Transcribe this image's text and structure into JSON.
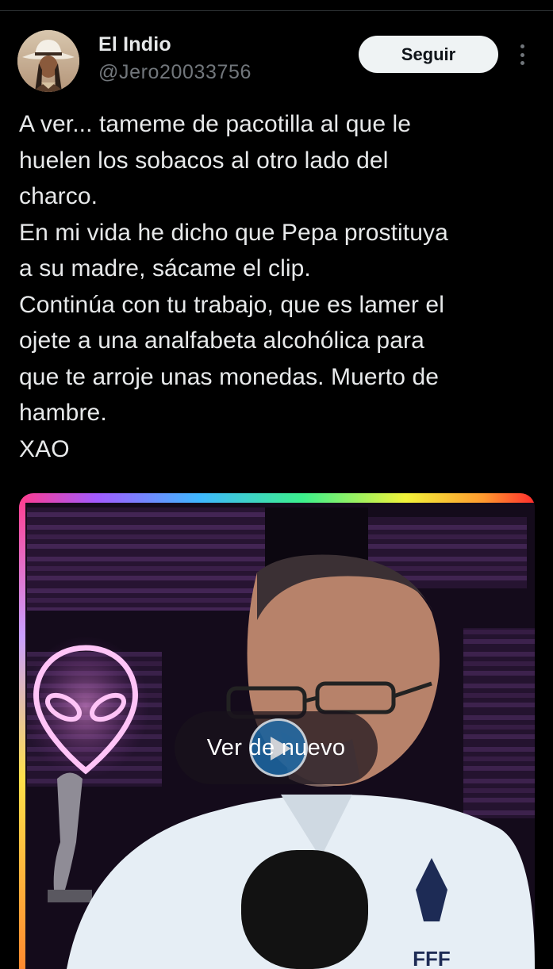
{
  "author": {
    "display_name": "El Indio",
    "handle": "@Jero20033756",
    "avatar_icon": "avatar-photo-cowboy-hat"
  },
  "actions": {
    "follow_label": "Seguir",
    "more_icon": "more-vertical-icon"
  },
  "tweet": {
    "lines": [
      "A ver... tameme de pacotilla al que le",
      "huelen los sobacos al otro lado del",
      "charco.",
      "En mi vida he dicho que Pepa prostituya",
      "a su madre, sácame el clip.",
      "Continúa con tu trabajo, que es lamer el",
      "ojete a una analfabeta alcohólica para",
      "que te arroje unas monedas. Muerto de",
      "hambre.",
      "XAO"
    ]
  },
  "media": {
    "type": "video",
    "replay_label": "Ver de nuevo",
    "replay_icon": "play-icon",
    "jersey_badge_text": "FFF"
  },
  "colors": {
    "background": "#000000",
    "text_primary": "#e7e9ea",
    "text_secondary": "#71767b",
    "follow_button_bg": "#eff3f4",
    "divider": "#2f3336"
  }
}
